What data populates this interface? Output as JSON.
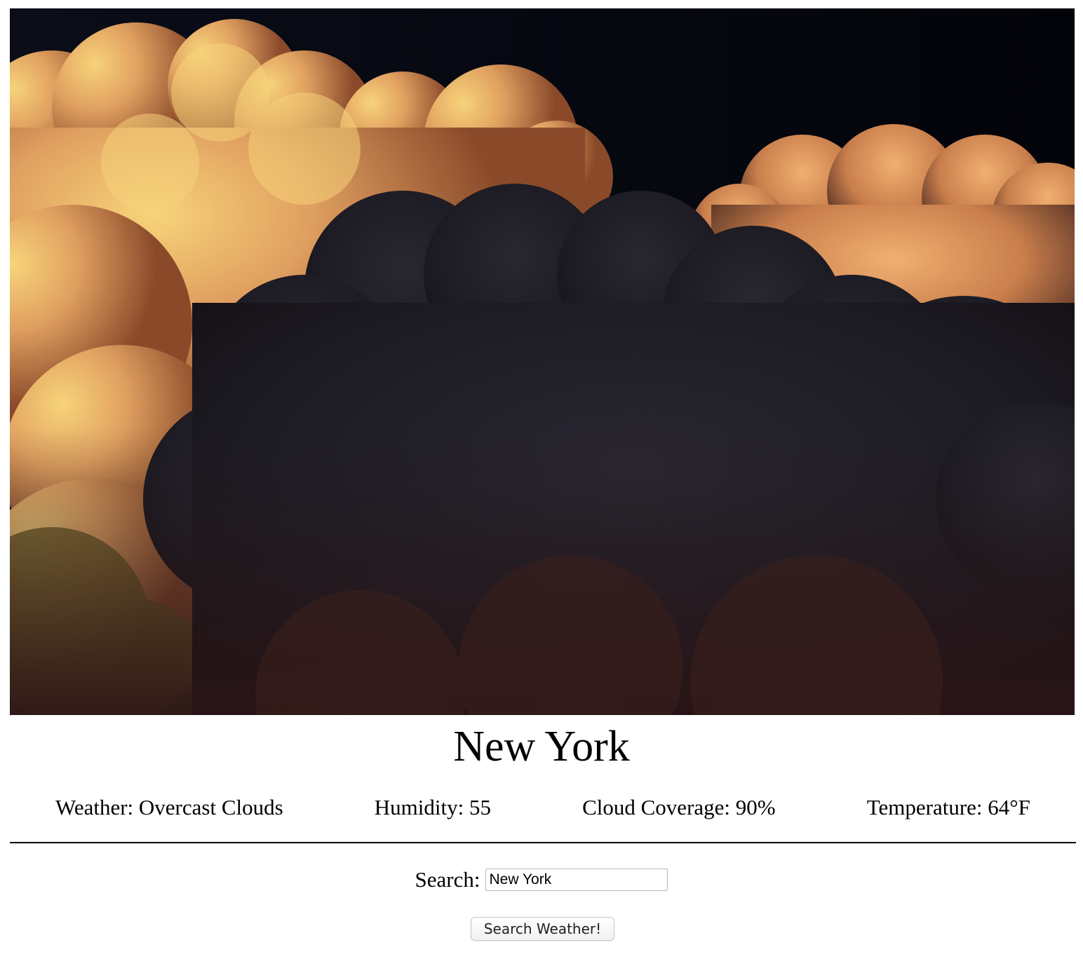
{
  "hero": {
    "image": "storm-clouds-photo"
  },
  "city": {
    "name": "New York"
  },
  "stats": {
    "weather": "Weather: Overcast Clouds",
    "humidity": "Humidity: 55",
    "cloud_coverage": "Cloud Coverage: 90%",
    "temperature": "Temperature: 64°F"
  },
  "search": {
    "label": "Search:",
    "value": "New York",
    "button_label": "Search Weather!"
  },
  "colors": {
    "sky": "#05070f",
    "cloud_highlight": "#f4c46a",
    "cloud_orange": "#d8894f",
    "cloud_dark": "#1c1a22",
    "divider": "#000000"
  }
}
